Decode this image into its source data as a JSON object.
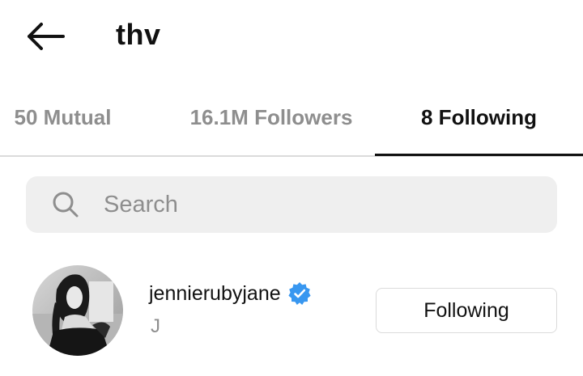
{
  "header": {
    "back_icon": "arrow-left-icon",
    "title": "thv"
  },
  "tabs": [
    {
      "id": "mutual",
      "label": "50 Mutual",
      "active": false
    },
    {
      "id": "followers",
      "label": "16.1M Followers",
      "active": false
    },
    {
      "id": "following",
      "label": "8 Following",
      "active": true
    }
  ],
  "search": {
    "icon": "search-icon",
    "placeholder": "Search",
    "value": ""
  },
  "list": [
    {
      "username": "jennierubyjane",
      "full_name": "J",
      "verified": true,
      "button_label": "Following"
    }
  ],
  "colors": {
    "text_primary": "#111111",
    "text_secondary": "#8e8e8e",
    "search_bg": "#efefef",
    "divider": "#dbdbdb",
    "verified_blue": "#3897f0"
  }
}
